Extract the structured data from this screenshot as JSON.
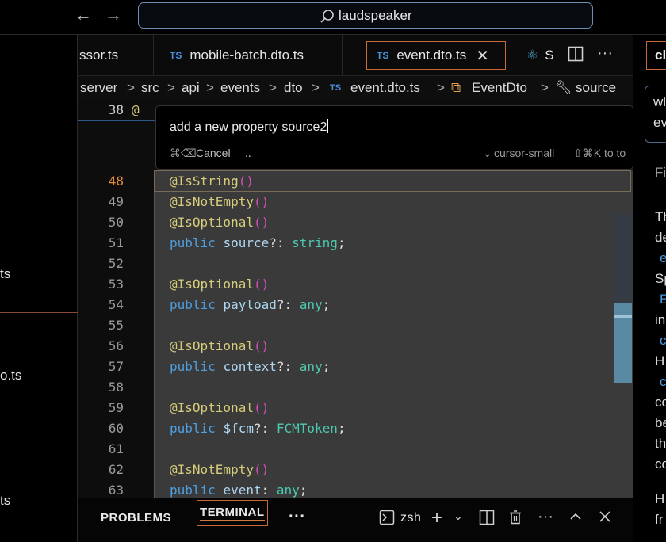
{
  "titlebar": {
    "back_icon": "arrow-left-icon",
    "forward_icon": "arrow-right-icon",
    "search_label": "laudspeaker"
  },
  "left_panel": {
    "items": [
      "ts",
      "o.ts",
      "ts"
    ]
  },
  "tabs": [
    {
      "label": "ssor.ts",
      "lang": ""
    },
    {
      "label": "mobile-batch.dto.ts",
      "lang": "TS"
    },
    {
      "label": "event.dto.ts",
      "lang": "TS",
      "active": true
    },
    {
      "label": "S",
      "lang": "react"
    }
  ],
  "breadcrumb": [
    "server",
    "src",
    "api",
    "events",
    "dto",
    "event.dto.ts",
    "EventDto",
    "source"
  ],
  "breadcrumb_file_badge": "TS",
  "prompt": {
    "text": "add a new property source2",
    "cancel_label": "Cancel",
    "cancel_shortcut": "⌘⌫",
    "dots": "..",
    "model": "cursor-small",
    "shortcut_hint": "⇧⌘K to to"
  },
  "editor": {
    "top_line_number": "38",
    "top_line_code": "@",
    "lines": [
      {
        "n": "48",
        "current": true
      },
      {
        "n": "49"
      },
      {
        "n": "50"
      },
      {
        "n": "51"
      },
      {
        "n": "52"
      },
      {
        "n": "53"
      },
      {
        "n": "54"
      },
      {
        "n": "55"
      },
      {
        "n": "56"
      },
      {
        "n": "57"
      },
      {
        "n": "58"
      },
      {
        "n": "59"
      },
      {
        "n": "60"
      },
      {
        "n": "61"
      },
      {
        "n": "62"
      },
      {
        "n": "63"
      }
    ],
    "tokens": {
      "IsString": "@IsString",
      "IsNotEmpty": "@IsNotEmpty",
      "IsOptional": "@IsOptional",
      "parens": "()",
      "public": "public",
      "source": "source",
      "payload": "payload",
      "context": "context",
      "fcm": "$fcm",
      "event": "event",
      "opt_colon": "?:",
      "colon": ":",
      "string": "string",
      "any": "any",
      "FCMToken": "FCMToken",
      "semicolon": ";"
    }
  },
  "panel": {
    "problems_label": "PROBLEMS",
    "terminal_label": "TERMINAL",
    "more_label": "···",
    "shell_label": "zsh"
  },
  "right_panel": {
    "tab_label": "cl",
    "lines": [
      "wl",
      "ev",
      "Fi",
      "Th",
      "de",
      "e",
      "Sp",
      "E",
      "in",
      "c",
      "H",
      "c",
      "co",
      "be",
      "th",
      "co",
      "H",
      "fr"
    ]
  },
  "colors": {
    "accent_orange": "#c96a3a",
    "ts_blue": "#4b8fd9",
    "decorator": "#d7cc7b",
    "keyword": "#4e9fe0",
    "type": "#4ec9b0"
  }
}
